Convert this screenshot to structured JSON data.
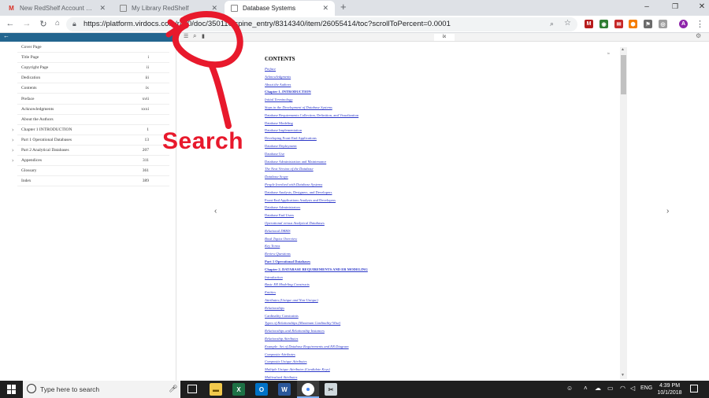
{
  "tabs": [
    {
      "title": "New RedShelf Account Setup - a",
      "icon": "gmail-icon"
    },
    {
      "title": "My Library RedShelf",
      "icon": "page-icon"
    },
    {
      "title": "Database Systems",
      "icon": "page-icon"
    }
  ],
  "toolbar": {
    "url": "https://platform.virdocs.com/r/s/0/doc/350110/spine_entry/8314340/item/26055414/toc?scrollToPercent=0.0001",
    "profile_initial": "A"
  },
  "reader": {
    "page_box": "ix"
  },
  "toc": [
    {
      "label": "Cover Page",
      "page": "",
      "expandable": false
    },
    {
      "label": "Title Page",
      "page": "i",
      "expandable": false
    },
    {
      "label": "Copyright Page",
      "page": "ii",
      "expandable": false
    },
    {
      "label": "Dedication",
      "page": "iii",
      "expandable": false
    },
    {
      "label": "Contents",
      "page": "ix",
      "expandable": false
    },
    {
      "label": "Preface",
      "page": "xvii",
      "expandable": false
    },
    {
      "label": "Acknowledgments",
      "page": "xxxi",
      "expandable": false
    },
    {
      "label": "About the Authors",
      "page": "",
      "expandable": false
    },
    {
      "label": "Chapter 1 INTRODUCTION",
      "page": "1",
      "expandable": true
    },
    {
      "label": "Part 1 Operational Databases",
      "page": "13",
      "expandable": true
    },
    {
      "label": "Part 2 Analytical Databases",
      "page": "207",
      "expandable": true
    },
    {
      "label": "Appendices",
      "page": "311",
      "expandable": true
    },
    {
      "label": "Glossary",
      "page": "361",
      "expandable": false
    },
    {
      "label": "Index",
      "page": "389",
      "expandable": false
    }
  ],
  "contents": {
    "heading": "CONTENTS",
    "page_marker": "ix",
    "entries": [
      {
        "text": "Preface",
        "style": "it"
      },
      {
        "text": "Acknowledgments",
        "style": "it"
      },
      {
        "text": "About the Authors",
        "style": "it"
      },
      {
        "text": "Chapter 1. INTRODUCTION",
        "style": "b"
      },
      {
        "text": "Initial Terminology",
        "style": "it"
      },
      {
        "text": "Steps in the Development of Database Systems",
        "style": "it"
      },
      {
        "text": "Database Requirements Collection, Definition, and Visualization",
        "style": ""
      },
      {
        "text": "Database Modeling",
        "style": ""
      },
      {
        "text": "Database Implementation",
        "style": ""
      },
      {
        "text": "Developing Front-End Applications",
        "style": ""
      },
      {
        "text": "Database Deployment",
        "style": ""
      },
      {
        "text": "Database Use",
        "style": ""
      },
      {
        "text": "Database Administration and Maintenance",
        "style": ""
      },
      {
        "text": "The Next Version of the Database",
        "style": "it"
      },
      {
        "text": "Database Scope",
        "style": "it"
      },
      {
        "text": "People Involved with Database Systems",
        "style": "it"
      },
      {
        "text": "Database Analysts, Designers, and Developers",
        "style": ""
      },
      {
        "text": "Front-End Applications Analysts and Developers",
        "style": ""
      },
      {
        "text": "Database Administrators",
        "style": ""
      },
      {
        "text": "Database End Users",
        "style": ""
      },
      {
        "text": "Operational versus Analytical Databases",
        "style": "it"
      },
      {
        "text": "Relational DBMS",
        "style": "it"
      },
      {
        "text": "Book Topics Overview",
        "style": "it"
      },
      {
        "text": "Key Terms",
        "style": "it"
      },
      {
        "text": "Review Questions",
        "style": "it"
      },
      {
        "text": "Part 1 Operational Databases",
        "style": "b"
      },
      {
        "text": "Chapter 2. DATABASE REQUIREMENTS AND ER MODELING",
        "style": "b"
      },
      {
        "text": "Introduction",
        "style": "it"
      },
      {
        "text": "Basic ER Modeling Constructs",
        "style": "it"
      },
      {
        "text": "Entities",
        "style": "it"
      },
      {
        "text": "Attributes (Unique and Non-Unique)",
        "style": "it"
      },
      {
        "text": "Relationships",
        "style": "it"
      },
      {
        "text": "Cardinality Constraints",
        "style": ""
      },
      {
        "text": "Types of Relationships (Maximum Cardinality-Wise)",
        "style": "it"
      },
      {
        "text": "Relationships and Relationship Instances",
        "style": "it"
      },
      {
        "text": "Relationship Attributes",
        "style": "it"
      },
      {
        "text": "Example: Set of Database Requirements and ER Diagram",
        "style": "it"
      },
      {
        "text": "Composite Attributes",
        "style": "it"
      },
      {
        "text": "Composite Unique Attributes",
        "style": "it"
      },
      {
        "text": "Multiple Unique Attributes (Candidate Keys)",
        "style": "it"
      },
      {
        "text": "Multivalued Attributes",
        "style": "it"
      }
    ]
  },
  "annotation": {
    "text": "Search",
    "color": "#e8192c"
  },
  "taskbar": {
    "search_placeholder": "Type here to search",
    "language": "ENG",
    "time": "4:39 PM",
    "date": "10/1/2018"
  }
}
